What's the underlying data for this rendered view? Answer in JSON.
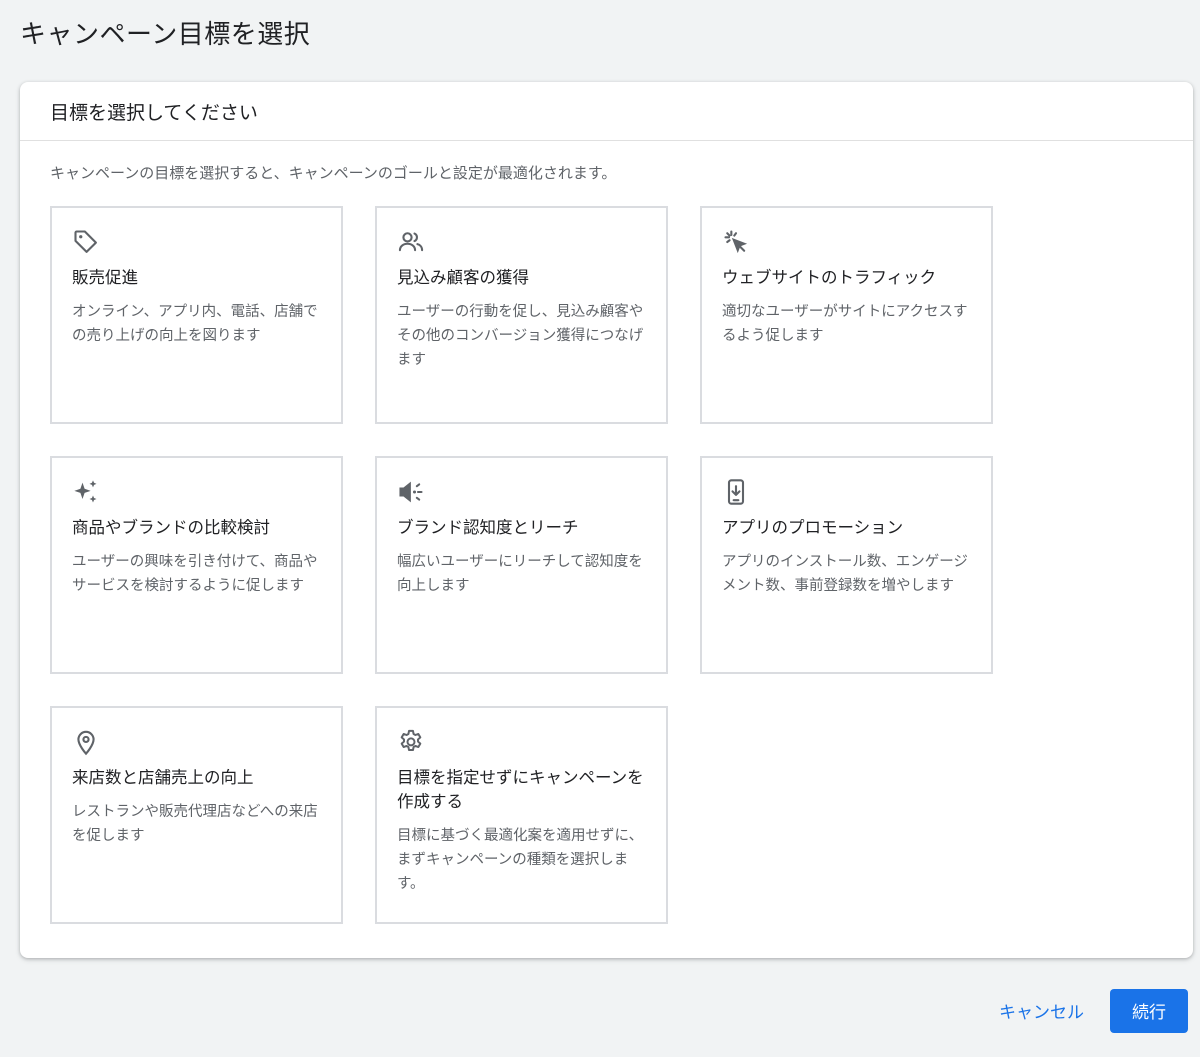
{
  "page": {
    "title": "キャンペーン目標を選択"
  },
  "card": {
    "header": "目標を選択してください",
    "description": "キャンペーンの目標を選択すると、キャンペーンのゴールと設定が最適化されます。"
  },
  "goals": [
    {
      "icon": "tag-icon",
      "title": "販売促進",
      "text": "オンライン、アプリ内、電話、店舗での売り上げの向上を図ります"
    },
    {
      "icon": "people-icon",
      "title": "見込み顧客の獲得",
      "text": "ユーザーの行動を促し、見込み顧客やその他のコンバージョン獲得につなげます"
    },
    {
      "icon": "cursor-click-icon",
      "title": "ウェブサイトのトラフィック",
      "text": "適切なユーザーがサイトにアクセスするよう促します"
    },
    {
      "icon": "sparkle-icon",
      "title": "商品やブランドの比較検討",
      "text": "ユーザーの興味を引き付けて、商品やサービスを検討するように促します"
    },
    {
      "icon": "megaphone-icon",
      "title": "ブランド認知度とリーチ",
      "text": "幅広いユーザーにリーチして認知度を向上します"
    },
    {
      "icon": "phone-download-icon",
      "title": "アプリのプロモーション",
      "text": "アプリのインストール数、エンゲージメント数、事前登録数を増やします"
    },
    {
      "icon": "location-pin-icon",
      "title": "来店数と店舗売上の向上",
      "text": "レストランや販売代理店などへの来店を促します"
    },
    {
      "icon": "gear-icon",
      "title": "目標を指定せずにキャンペーンを作成する",
      "text": "目標に基づく最適化案を適用せずに、まずキャンペーンの種類を選択します。"
    }
  ],
  "footer": {
    "cancel_label": "キャンセル",
    "continue_label": "続行"
  },
  "colors": {
    "accent": "#1a73e8",
    "icon": "#5f6368",
    "border": "#dadce0"
  }
}
